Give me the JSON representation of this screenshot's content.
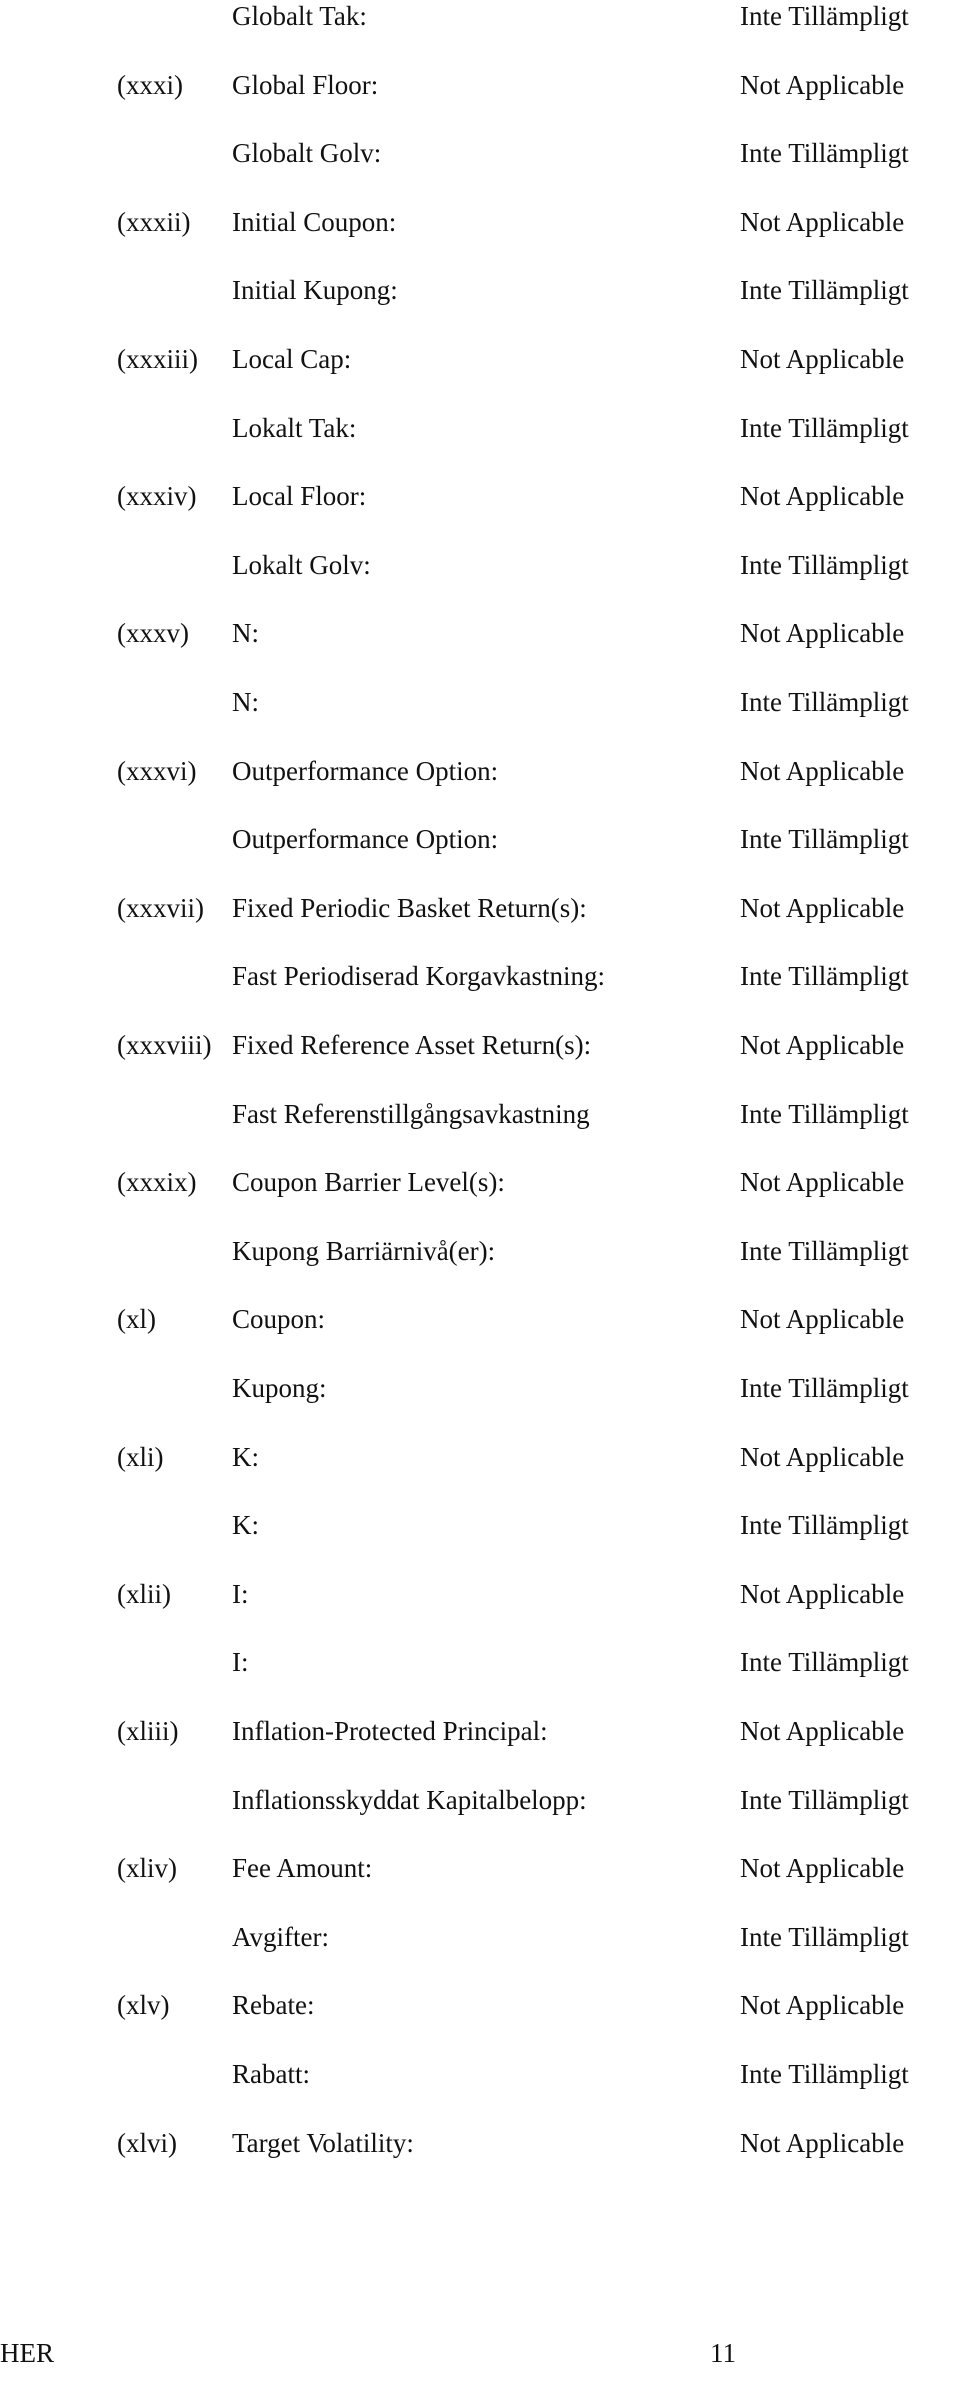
{
  "rows": [
    {
      "num": "",
      "label": "Globalt Tak:",
      "value": "Inte Tillämpligt"
    },
    {
      "num": "(xxxi)",
      "label": "Global Floor:",
      "value": "Not Applicable"
    },
    {
      "num": "",
      "label": "Globalt Golv:",
      "value": "Inte Tillämpligt"
    },
    {
      "num": "(xxxii)",
      "label": "Initial Coupon:",
      "value": "Not Applicable"
    },
    {
      "num": "",
      "label": "Initial Kupong:",
      "value": "Inte Tillämpligt"
    },
    {
      "num": "(xxxiii)",
      "label": "Local Cap:",
      "value": "Not Applicable"
    },
    {
      "num": "",
      "label": "Lokalt Tak:",
      "value": "Inte Tillämpligt"
    },
    {
      "num": "(xxxiv)",
      "label": "Local Floor:",
      "value": "Not Applicable"
    },
    {
      "num": "",
      "label": "Lokalt Golv:",
      "value": "Inte Tillämpligt"
    },
    {
      "num": "(xxxv)",
      "label": "N:",
      "value": "Not Applicable"
    },
    {
      "num": "",
      "label": "N:",
      "value": "Inte Tillämpligt"
    },
    {
      "num": "(xxxvi)",
      "label": "Outperformance Option:",
      "value": "Not Applicable"
    },
    {
      "num": "",
      "label": "Outperformance Option:",
      "value": "Inte Tillämpligt"
    },
    {
      "num": "(xxxvii)",
      "label": "Fixed Periodic Basket Return(s):",
      "value": "Not Applicable"
    },
    {
      "num": "",
      "label": "Fast Periodiserad Korgavkastning:",
      "value": "Inte Tillämpligt"
    },
    {
      "num": "(xxxviii)",
      "label": "Fixed Reference Asset Return(s):",
      "value": "Not Applicable"
    },
    {
      "num": "",
      "label": "Fast Referenstillgångsavkastning",
      "value": "Inte Tillämpligt"
    },
    {
      "num": "(xxxix)",
      "label": "Coupon Barrier Level(s):",
      "value": "Not Applicable"
    },
    {
      "num": "",
      "label": "Kupong Barriärnivå(er):",
      "value": "Inte Tillämpligt"
    },
    {
      "num": "(xl)",
      "label": "Coupon:",
      "value": "Not Applicable"
    },
    {
      "num": "",
      "label": "Kupong:",
      "value": "Inte Tillämpligt"
    },
    {
      "num": "(xli)",
      "label": "K:",
      "value": "Not Applicable"
    },
    {
      "num": "",
      "label": "K:",
      "value": "Inte Tillämpligt"
    },
    {
      "num": "(xlii)",
      "label": "I:",
      "value": "Not Applicable"
    },
    {
      "num": "",
      "label": "I:",
      "value": "Inte Tillämpligt"
    },
    {
      "num": "(xliii)",
      "label": "Inflation-Protected Principal:",
      "value": "Not Applicable"
    },
    {
      "num": "",
      "label": "Inflationsskyddat Kapitalbelopp:",
      "value": "Inte Tillämpligt"
    },
    {
      "num": "(xliv)",
      "label": "Fee Amount:",
      "value": "Not Applicable"
    },
    {
      "num": "",
      "label": "Avgifter:",
      "value": "Inte Tillämpligt"
    },
    {
      "num": "(xlv)",
      "label": "Rebate:",
      "value": "Not Applicable"
    },
    {
      "num": "",
      "label": "Rabatt:",
      "value": "Inte Tillämpligt"
    },
    {
      "num": "(xlvi)",
      "label": "Target Volatility:",
      "value": "Not Applicable"
    }
  ],
  "footer": {
    "left": "HER",
    "page": "11"
  }
}
